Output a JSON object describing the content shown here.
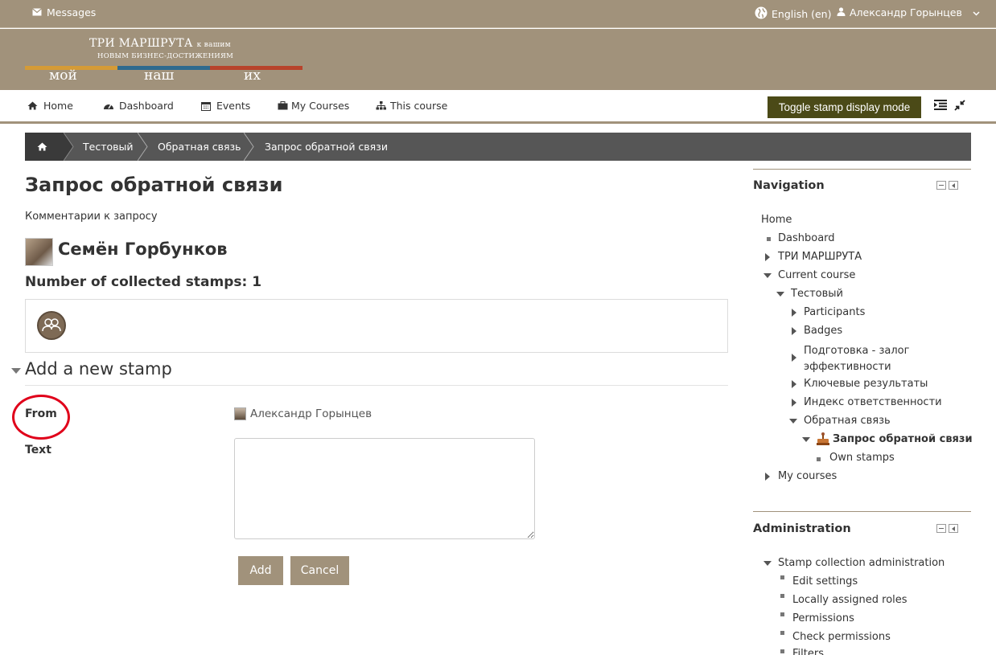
{
  "topbar": {
    "messages": "Messages",
    "language": "English (en)",
    "user": "Александр Горынцев"
  },
  "logo": {
    "line1_main": "ТРИ МАРШРУТА",
    "line1_small": "к вашим",
    "line2": "НОВЫМ БИЗНЕС-ДОСТИЖЕНИЯМ",
    "word1": "мой",
    "word2": "наш",
    "word3": "их",
    "stripe_colors": [
      "#d49b37",
      "#2f6a8e",
      "#b8432b"
    ]
  },
  "nav": {
    "home": "Home",
    "dashboard": "Dashboard",
    "events": "Events",
    "my_courses": "My Courses",
    "this_course": "This course",
    "toggle": "Toggle stamp display mode"
  },
  "breadcrumb": [
    "Тестовый",
    "Обратная связь",
    "Запрос обратной связи"
  ],
  "main": {
    "title": "Запрос обратной связи",
    "subtitle": "Комментарии к запросу",
    "person": "Семён Горбунков",
    "collected": "Number of collected stamps: 1",
    "legend": "Add a new stamp",
    "from_label": "From",
    "from_value": "Александр Горынцев",
    "text_label": "Text",
    "add": "Add",
    "cancel": "Cancel"
  },
  "navigation_block": {
    "title": "Navigation",
    "home": "Home",
    "dashboard": "Dashboard",
    "tri": "ТРИ МАРШРУТА",
    "current_course": "Current course",
    "test": "Тестовый",
    "participants": "Participants",
    "badges": "Badges",
    "prep_1": "Подготовка - залог",
    "prep_2": "эффективности",
    "key_results": "Ключевые результаты",
    "responsibility": "Индекс ответственности",
    "feedback": "Обратная связь",
    "request": "Запрос обратной связи",
    "own_stamps": "Own stamps",
    "my_courses": "My courses"
  },
  "admin_block": {
    "title": "Administration",
    "stamp_admin": "Stamp collection administration",
    "edit_settings": "Edit settings",
    "local_roles": "Locally assigned roles",
    "permissions": "Permissions",
    "check_permissions": "Check permissions",
    "filters": "Filters"
  }
}
